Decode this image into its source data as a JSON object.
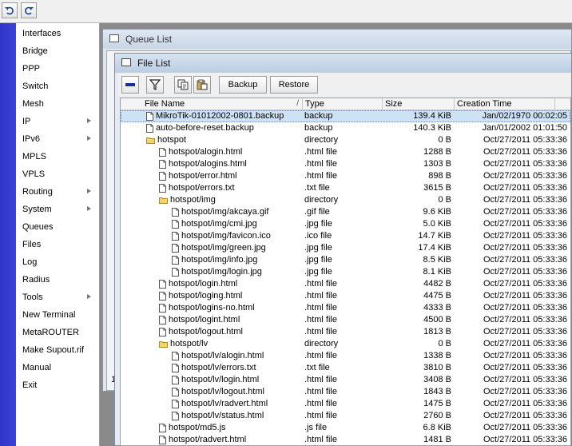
{
  "toolbar": {
    "undo_icon": "undo-icon",
    "redo_icon": "redo-icon"
  },
  "sidebar": {
    "items": [
      {
        "label": "Interfaces",
        "submenu": false
      },
      {
        "label": "Bridge",
        "submenu": false
      },
      {
        "label": "PPP",
        "submenu": false
      },
      {
        "label": "Switch",
        "submenu": false
      },
      {
        "label": "Mesh",
        "submenu": false
      },
      {
        "label": "IP",
        "submenu": true
      },
      {
        "label": "IPv6",
        "submenu": true
      },
      {
        "label": "MPLS",
        "submenu": false
      },
      {
        "label": "VPLS",
        "submenu": false
      },
      {
        "label": "Routing",
        "submenu": true
      },
      {
        "label": "System",
        "submenu": true
      },
      {
        "label": "Queues",
        "submenu": false
      },
      {
        "label": "Files",
        "submenu": false
      },
      {
        "label": "Log",
        "submenu": false
      },
      {
        "label": "Radius",
        "submenu": false
      },
      {
        "label": "Tools",
        "submenu": true
      },
      {
        "label": "New Terminal",
        "submenu": false
      },
      {
        "label": "MetaROUTER",
        "submenu": false
      },
      {
        "label": "Make Supout.rif",
        "submenu": false
      },
      {
        "label": "Manual",
        "submenu": false
      },
      {
        "label": "Exit",
        "submenu": false
      }
    ]
  },
  "queue_window": {
    "title": "Queue List",
    "footer": "1"
  },
  "file_window": {
    "title": "File List",
    "buttons": {
      "backup": "Backup",
      "restore": "Restore"
    },
    "columns": {
      "name": "File Name",
      "type": "Type",
      "size": "Size",
      "time": "Creation Time"
    },
    "rows": [
      {
        "name": "MikroTik-01012002-0801.backup",
        "type": "backup",
        "size": "139.4 KiB",
        "time": "Jan/02/1970 00:02:05",
        "indent": 0,
        "kind": "file",
        "selected": true
      },
      {
        "name": "auto-before-reset.backup",
        "type": "backup",
        "size": "140.3 KiB",
        "time": "Jan/01/2002 01:01:50",
        "indent": 0,
        "kind": "file",
        "selected": false
      },
      {
        "name": "hotspot",
        "type": "directory",
        "size": "0 B",
        "time": "Oct/27/2011 05:33:36",
        "indent": 0,
        "kind": "folder",
        "selected": false
      },
      {
        "name": "hotspot/alogin.html",
        "type": ".html file",
        "size": "1288 B",
        "time": "Oct/27/2011 05:33:36",
        "indent": 1,
        "kind": "file",
        "selected": false
      },
      {
        "name": "hotspot/alogins.html",
        "type": ".html file",
        "size": "1303 B",
        "time": "Oct/27/2011 05:33:36",
        "indent": 1,
        "kind": "file",
        "selected": false
      },
      {
        "name": "hotspot/error.html",
        "type": ".html file",
        "size": "898 B",
        "time": "Oct/27/2011 05:33:36",
        "indent": 1,
        "kind": "file",
        "selected": false
      },
      {
        "name": "hotspot/errors.txt",
        "type": ".txt file",
        "size": "3615 B",
        "time": "Oct/27/2011 05:33:36",
        "indent": 1,
        "kind": "file",
        "selected": false
      },
      {
        "name": "hotspot/img",
        "type": "directory",
        "size": "0 B",
        "time": "Oct/27/2011 05:33:36",
        "indent": 1,
        "kind": "folder",
        "selected": false
      },
      {
        "name": "hotspot/img/akcaya.gif",
        "type": ".gif file",
        "size": "9.6 KiB",
        "time": "Oct/27/2011 05:33:36",
        "indent": 2,
        "kind": "file",
        "selected": false
      },
      {
        "name": "hotspot/img/cmi.jpg",
        "type": ".jpg file",
        "size": "5.0 KiB",
        "time": "Oct/27/2011 05:33:36",
        "indent": 2,
        "kind": "file",
        "selected": false
      },
      {
        "name": "hotspot/img/favicon.ico",
        "type": ".ico file",
        "size": "14.7 KiB",
        "time": "Oct/27/2011 05:33:36",
        "indent": 2,
        "kind": "file",
        "selected": false
      },
      {
        "name": "hotspot/img/green.jpg",
        "type": ".jpg file",
        "size": "17.4 KiB",
        "time": "Oct/27/2011 05:33:36",
        "indent": 2,
        "kind": "file",
        "selected": false
      },
      {
        "name": "hotspot/img/info.jpg",
        "type": ".jpg file",
        "size": "8.5 KiB",
        "time": "Oct/27/2011 05:33:36",
        "indent": 2,
        "kind": "file",
        "selected": false
      },
      {
        "name": "hotspot/img/login.jpg",
        "type": ".jpg file",
        "size": "8.1 KiB",
        "time": "Oct/27/2011 05:33:36",
        "indent": 2,
        "kind": "file",
        "selected": false
      },
      {
        "name": "hotspot/login.html",
        "type": ".html file",
        "size": "4482 B",
        "time": "Oct/27/2011 05:33:36",
        "indent": 1,
        "kind": "file",
        "selected": false
      },
      {
        "name": "hotspot/loging.html",
        "type": ".html file",
        "size": "4475 B",
        "time": "Oct/27/2011 05:33:36",
        "indent": 1,
        "kind": "file",
        "selected": false
      },
      {
        "name": "hotspot/logins-no.html",
        "type": ".html file",
        "size": "4333 B",
        "time": "Oct/27/2011 05:33:36",
        "indent": 1,
        "kind": "file",
        "selected": false
      },
      {
        "name": "hotspot/logint.html",
        "type": ".html file",
        "size": "4500 B",
        "time": "Oct/27/2011 05:33:36",
        "indent": 1,
        "kind": "file",
        "selected": false
      },
      {
        "name": "hotspot/logout.html",
        "type": ".html file",
        "size": "1813 B",
        "time": "Oct/27/2011 05:33:36",
        "indent": 1,
        "kind": "file",
        "selected": false
      },
      {
        "name": "hotspot/lv",
        "type": "directory",
        "size": "0 B",
        "time": "Oct/27/2011 05:33:36",
        "indent": 1,
        "kind": "folder",
        "selected": false
      },
      {
        "name": "hotspot/lv/alogin.html",
        "type": ".html file",
        "size": "1338 B",
        "time": "Oct/27/2011 05:33:36",
        "indent": 2,
        "kind": "file",
        "selected": false
      },
      {
        "name": "hotspot/lv/errors.txt",
        "type": ".txt file",
        "size": "3810 B",
        "time": "Oct/27/2011 05:33:36",
        "indent": 2,
        "kind": "file",
        "selected": false
      },
      {
        "name": "hotspot/lv/login.html",
        "type": ".html file",
        "size": "3408 B",
        "time": "Oct/27/2011 05:33:36",
        "indent": 2,
        "kind": "file",
        "selected": false
      },
      {
        "name": "hotspot/lv/logout.html",
        "type": ".html file",
        "size": "1843 B",
        "time": "Oct/27/2011 05:33:36",
        "indent": 2,
        "kind": "file",
        "selected": false
      },
      {
        "name": "hotspot/lv/radvert.html",
        "type": ".html file",
        "size": "1475 B",
        "time": "Oct/27/2011 05:33:36",
        "indent": 2,
        "kind": "file",
        "selected": false
      },
      {
        "name": "hotspot/lv/status.html",
        "type": ".html file",
        "size": "2760 B",
        "time": "Oct/27/2011 05:33:36",
        "indent": 2,
        "kind": "file",
        "selected": false
      },
      {
        "name": "hotspot/md5.js",
        "type": ".js file",
        "size": "6.8 KiB",
        "time": "Oct/27/2011 05:33:36",
        "indent": 1,
        "kind": "file",
        "selected": false
      },
      {
        "name": "hotspot/radvert.html",
        "type": ".html file",
        "size": "1481 B",
        "time": "Oct/27/2011 05:33:36",
        "indent": 1,
        "kind": "file",
        "selected": false
      }
    ]
  }
}
